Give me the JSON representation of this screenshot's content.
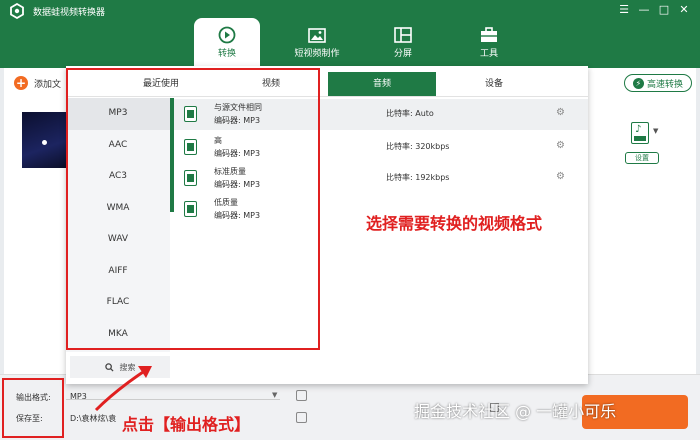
{
  "app": {
    "title": "数据蛙视频转换器"
  },
  "window_controls": [
    "☰",
    "—",
    "□",
    "✕"
  ],
  "main_tabs": [
    {
      "label": "转换",
      "active": true
    },
    {
      "label": "短视频制作"
    },
    {
      "label": "分屏"
    },
    {
      "label": "工具"
    }
  ],
  "toolbar": {
    "add_file_label": "添加文",
    "fast_convert_label": "高速转换"
  },
  "file_item": {
    "settings_label": "设置"
  },
  "format_dialog": {
    "tabs": [
      {
        "label": "最近使用"
      },
      {
        "label": "视频"
      },
      {
        "label": "音频",
        "active": true
      },
      {
        "label": "设备"
      }
    ],
    "formats": [
      "MP3",
      "AAC",
      "AC3",
      "WMA",
      "WAV",
      "AIFF",
      "FLAC",
      "MKA"
    ],
    "selected_format": "MP3",
    "search_label": "搜索",
    "qualities": [
      {
        "name": "与源文件相同",
        "encoder": "编码器:  MP3",
        "bitrate": "比特率:  Auto"
      },
      {
        "name": "高",
        "encoder": "编码器:  MP3",
        "bitrate": "比特率:  320kbps"
      },
      {
        "name": "标准质量",
        "encoder": "编码器:  MP3",
        "bitrate": "比特率:  192kbps"
      },
      {
        "name": "低质量",
        "encoder": "编码器:  MP3",
        "bitrate": ""
      }
    ]
  },
  "bottom": {
    "output_format_label": "输出格式:",
    "output_format_value": "MP3",
    "save_to_label": "保存至:",
    "save_to_value": "D:\\袁林炫\\袁"
  },
  "annotations": {
    "select_format": "选择需要转换的视频格式",
    "click_output": "点击【输出格式】"
  },
  "watermark": "掘金技术社区 @ 一罐小可乐",
  "colors": {
    "brand_green": "#1f7a45",
    "accent_orange": "#f26b22",
    "annotation_red": "#e02020"
  }
}
